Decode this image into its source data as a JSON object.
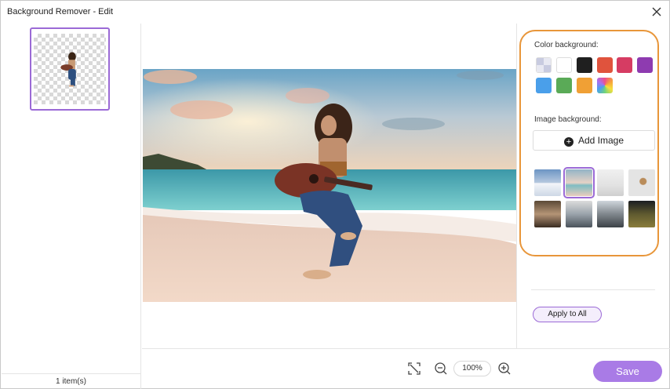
{
  "window": {
    "title": "Background Remover - Edit"
  },
  "left_panel": {
    "item_count": "1 item(s)"
  },
  "toolbar": {
    "zoom_level": "100%",
    "save_label": "Save"
  },
  "right_panel": {
    "color_label": "Color background:",
    "image_label": "Image background:",
    "add_image_label": "Add Image",
    "apply_all_label": "Apply to All",
    "colors": [
      "transparent",
      "#ffffff",
      "#1f1f1f",
      "#e0533d",
      "#d63c63",
      "#8e3bb0",
      "#4a9fea",
      "#5aaa57",
      "#f0a035",
      "gradient"
    ],
    "image_backgrounds": [
      "snowy-mountains",
      "beach-sunset",
      "white-room",
      "desk-flatlay",
      "cafe-interior",
      "office-interior",
      "building-interior",
      "city-night"
    ],
    "selected_image_background": "beach-sunset"
  },
  "accent_colors": {
    "primary": "#a97be6",
    "highlight": "#e8963a"
  }
}
